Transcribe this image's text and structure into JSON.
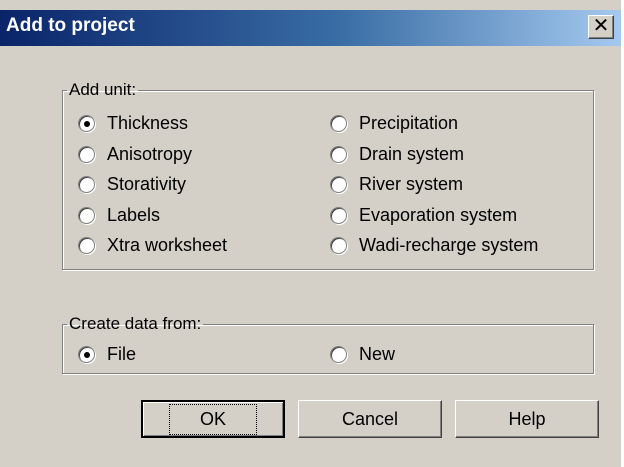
{
  "dialog": {
    "title": "Add to project",
    "close_glyph": "✕"
  },
  "add_unit": {
    "legend": "Add unit:",
    "options": [
      {
        "label": "Thickness",
        "checked": true
      },
      {
        "label": "Anisotropy",
        "checked": false
      },
      {
        "label": "Storativity",
        "checked": false
      },
      {
        "label": "Labels",
        "checked": false
      },
      {
        "label": "Xtra worksheet",
        "checked": false
      },
      {
        "label": "Precipitation",
        "checked": false
      },
      {
        "label": "Drain system",
        "checked": false
      },
      {
        "label": "River system",
        "checked": false
      },
      {
        "label": "Evaporation system",
        "checked": false
      },
      {
        "label": "Wadi-recharge system",
        "checked": false
      }
    ]
  },
  "create_from": {
    "legend": "Create data from:",
    "options": [
      {
        "label": "File",
        "checked": true
      },
      {
        "label": "New",
        "checked": false
      }
    ]
  },
  "buttons": {
    "ok": "OK",
    "cancel": "Cancel",
    "help": "Help"
  }
}
